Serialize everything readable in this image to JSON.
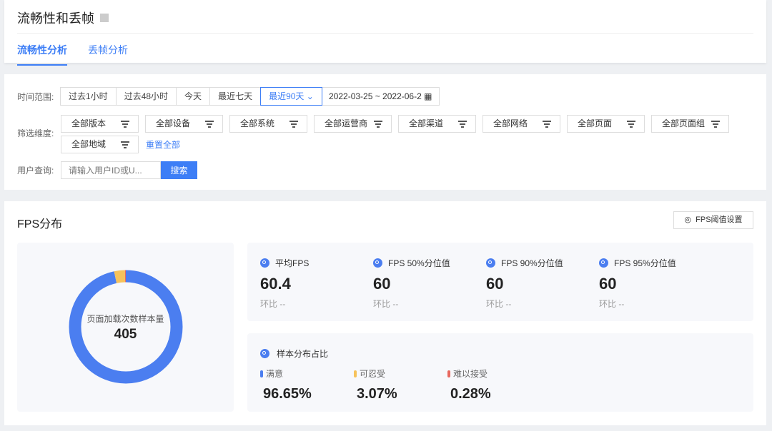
{
  "header": {
    "title": "流畅性和丢帧",
    "tabs": [
      {
        "label": "流畅性分析",
        "active": true
      },
      {
        "label": "丢帧分析",
        "active": false
      }
    ]
  },
  "filters": {
    "time_label": "时间范围:",
    "time_options": [
      "过去1小时",
      "过去48小时",
      "今天",
      "最近七天",
      "最近90天 ⌄"
    ],
    "selected_time": "最近90天",
    "date_range": "2022-03-25 ~ 2022-06-2",
    "dim_label": "筛选维度:",
    "dims": [
      "全部版本",
      "全部设备",
      "全部系统",
      "全部运营商",
      "全部渠道",
      "全部网络",
      "全部页面",
      "全部页面组",
      "全部地域"
    ],
    "reset": "重置全部",
    "user_label": "用户查询:",
    "user_placeholder": "请输入用户ID或U...",
    "search_button": "搜索"
  },
  "fps": {
    "title": "FPS分布",
    "settings_button": "FPS阈值设置",
    "donut": {
      "label": "页面加载次数样本量",
      "value": "405"
    },
    "stats": [
      {
        "label": "平均FPS",
        "value": "60.4",
        "compare": "环比  --"
      },
      {
        "label": "FPS 50%分位值",
        "value": "60",
        "compare": "环比  --"
      },
      {
        "label": "FPS 90%分位值",
        "value": "60",
        "compare": "环比  --"
      },
      {
        "label": "FPS 95%分位值",
        "value": "60",
        "compare": "环比  --"
      }
    ],
    "distribution": {
      "title": "样本分布占比",
      "items": [
        {
          "label": "满意",
          "value": "96.65%",
          "pct": 96.65,
          "color": "#4b7ef0"
        },
        {
          "label": "可忍受",
          "value": "3.07%",
          "pct": 3.07,
          "color": "#f6c25b"
        },
        {
          "label": "难以接受",
          "value": "0.28%",
          "pct": 0.28,
          "color": "#e8685e"
        }
      ]
    }
  }
}
